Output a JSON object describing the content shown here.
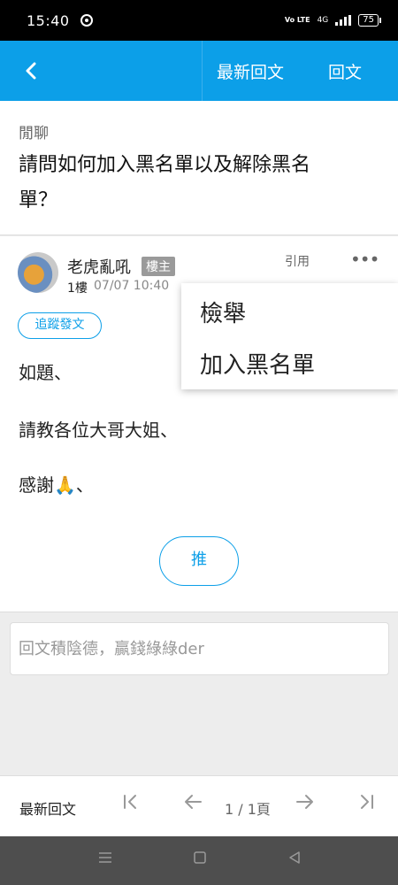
{
  "status_bar": {
    "time": "15:40",
    "network_label": "4G",
    "volte_label": "Vo LTE",
    "battery": "75"
  },
  "top_bar": {
    "back_icon": "chevron-left-icon",
    "latest_replies": "最新回文",
    "reply": "回文"
  },
  "thread": {
    "board": "閒聊",
    "title_line1": "請問如何加入黑名單以及解除黑名",
    "title_line2": "單？"
  },
  "post": {
    "author": "老虎亂吼",
    "op_badge": "樓主",
    "floor": "1樓",
    "time": "07/07 10:40",
    "quote": "引用",
    "follow": "追蹤發文",
    "body": [
      "如題、",
      "請教各位大哥大姐、",
      "感謝🙏、"
    ],
    "push": "推"
  },
  "menu": {
    "items": [
      "檢舉",
      "加入黑名單"
    ]
  },
  "reply_box": {
    "placeholder": "回文積陰德，贏錢綠綠der"
  },
  "bottom_bar": {
    "latest_replies": "最新回文",
    "page": "1 / 1頁"
  },
  "colors": {
    "accent": "#0c9fe8",
    "badge": "#9a9a9a"
  }
}
